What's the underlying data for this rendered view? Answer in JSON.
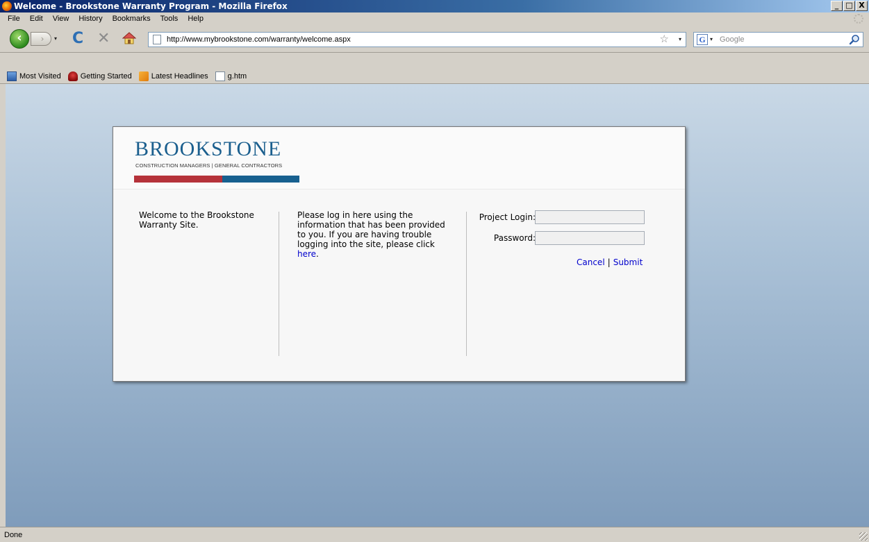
{
  "window": {
    "title": "Welcome - Brookstone Warranty Program - Mozilla Firefox",
    "minimize": "_",
    "maximize": "□",
    "close": "X"
  },
  "menu": [
    "File",
    "Edit",
    "View",
    "History",
    "Bookmarks",
    "Tools",
    "Help"
  ],
  "toolbar": {
    "back_glyph": "‹",
    "forward_glyph": "›",
    "dropdown_glyph": "▾",
    "reload_glyph": "C",
    "stop_glyph": "✕",
    "url": "http://www.mybrookstone.com/warranty/welcome.aspx",
    "star_glyph": "☆",
    "search_engine_letter": "G",
    "search_placeholder": "Google"
  },
  "bookmarks": [
    {
      "label": "Most Visited",
      "icon": "most-visited-icon"
    },
    {
      "label": "Getting Started",
      "icon": "getting-started-icon"
    },
    {
      "label": "Latest Headlines",
      "icon": "rss-feed-icon"
    },
    {
      "label": "g.htm",
      "icon": "page-icon"
    }
  ],
  "brand": {
    "name": "BROOKSTONE",
    "tagline": "CONSTRUCTION MANAGERS | GENERAL CONTRACTORS",
    "colors": {
      "red": "#b5323a",
      "blue": "#17608f",
      "text": "#1b5f8e"
    }
  },
  "welcome": {
    "text": "Welcome to the Brookstone Warranty Site."
  },
  "instructions": {
    "text": "Please log in here using the information that has been provided to you. If you are having trouble logging into the site, please click ",
    "link_label": "here",
    "suffix": "."
  },
  "login": {
    "project_login_label": "Project Login:",
    "project_login_value": "",
    "password_label": "Password:",
    "password_value": "",
    "cancel_label": "Cancel",
    "separator": "|",
    "submit_label": "Submit"
  },
  "status": {
    "text": "Done"
  }
}
